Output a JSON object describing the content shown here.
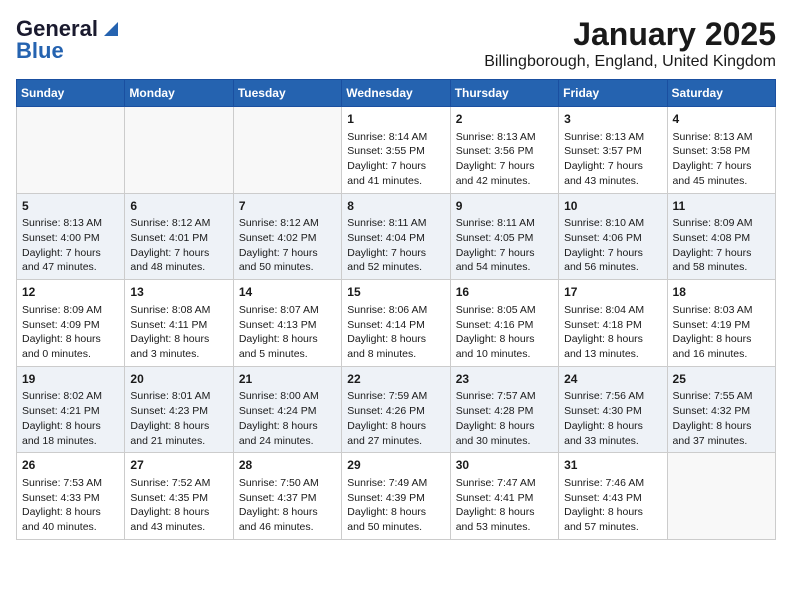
{
  "header": {
    "logo_line1": "General",
    "logo_line2": "Blue",
    "title": "January 2025",
    "subtitle": "Billingborough, England, United Kingdom"
  },
  "weekdays": [
    "Sunday",
    "Monday",
    "Tuesday",
    "Wednesday",
    "Thursday",
    "Friday",
    "Saturday"
  ],
  "weeks": [
    [
      {
        "day": "",
        "empty": true
      },
      {
        "day": "",
        "empty": true
      },
      {
        "day": "",
        "empty": true
      },
      {
        "day": "1",
        "lines": [
          "Sunrise: 8:14 AM",
          "Sunset: 3:55 PM",
          "Daylight: 7 hours",
          "and 41 minutes."
        ]
      },
      {
        "day": "2",
        "lines": [
          "Sunrise: 8:13 AM",
          "Sunset: 3:56 PM",
          "Daylight: 7 hours",
          "and 42 minutes."
        ]
      },
      {
        "day": "3",
        "lines": [
          "Sunrise: 8:13 AM",
          "Sunset: 3:57 PM",
          "Daylight: 7 hours",
          "and 43 minutes."
        ]
      },
      {
        "day": "4",
        "lines": [
          "Sunrise: 8:13 AM",
          "Sunset: 3:58 PM",
          "Daylight: 7 hours",
          "and 45 minutes."
        ]
      }
    ],
    [
      {
        "day": "5",
        "lines": [
          "Sunrise: 8:13 AM",
          "Sunset: 4:00 PM",
          "Daylight: 7 hours",
          "and 47 minutes."
        ]
      },
      {
        "day": "6",
        "lines": [
          "Sunrise: 8:12 AM",
          "Sunset: 4:01 PM",
          "Daylight: 7 hours",
          "and 48 minutes."
        ]
      },
      {
        "day": "7",
        "lines": [
          "Sunrise: 8:12 AM",
          "Sunset: 4:02 PM",
          "Daylight: 7 hours",
          "and 50 minutes."
        ]
      },
      {
        "day": "8",
        "lines": [
          "Sunrise: 8:11 AM",
          "Sunset: 4:04 PM",
          "Daylight: 7 hours",
          "and 52 minutes."
        ]
      },
      {
        "day": "9",
        "lines": [
          "Sunrise: 8:11 AM",
          "Sunset: 4:05 PM",
          "Daylight: 7 hours",
          "and 54 minutes."
        ]
      },
      {
        "day": "10",
        "lines": [
          "Sunrise: 8:10 AM",
          "Sunset: 4:06 PM",
          "Daylight: 7 hours",
          "and 56 minutes."
        ]
      },
      {
        "day": "11",
        "lines": [
          "Sunrise: 8:09 AM",
          "Sunset: 4:08 PM",
          "Daylight: 7 hours",
          "and 58 minutes."
        ]
      }
    ],
    [
      {
        "day": "12",
        "lines": [
          "Sunrise: 8:09 AM",
          "Sunset: 4:09 PM",
          "Daylight: 8 hours",
          "and 0 minutes."
        ]
      },
      {
        "day": "13",
        "lines": [
          "Sunrise: 8:08 AM",
          "Sunset: 4:11 PM",
          "Daylight: 8 hours",
          "and 3 minutes."
        ]
      },
      {
        "day": "14",
        "lines": [
          "Sunrise: 8:07 AM",
          "Sunset: 4:13 PM",
          "Daylight: 8 hours",
          "and 5 minutes."
        ]
      },
      {
        "day": "15",
        "lines": [
          "Sunrise: 8:06 AM",
          "Sunset: 4:14 PM",
          "Daylight: 8 hours",
          "and 8 minutes."
        ]
      },
      {
        "day": "16",
        "lines": [
          "Sunrise: 8:05 AM",
          "Sunset: 4:16 PM",
          "Daylight: 8 hours",
          "and 10 minutes."
        ]
      },
      {
        "day": "17",
        "lines": [
          "Sunrise: 8:04 AM",
          "Sunset: 4:18 PM",
          "Daylight: 8 hours",
          "and 13 minutes."
        ]
      },
      {
        "day": "18",
        "lines": [
          "Sunrise: 8:03 AM",
          "Sunset: 4:19 PM",
          "Daylight: 8 hours",
          "and 16 minutes."
        ]
      }
    ],
    [
      {
        "day": "19",
        "lines": [
          "Sunrise: 8:02 AM",
          "Sunset: 4:21 PM",
          "Daylight: 8 hours",
          "and 18 minutes."
        ]
      },
      {
        "day": "20",
        "lines": [
          "Sunrise: 8:01 AM",
          "Sunset: 4:23 PM",
          "Daylight: 8 hours",
          "and 21 minutes."
        ]
      },
      {
        "day": "21",
        "lines": [
          "Sunrise: 8:00 AM",
          "Sunset: 4:24 PM",
          "Daylight: 8 hours",
          "and 24 minutes."
        ]
      },
      {
        "day": "22",
        "lines": [
          "Sunrise: 7:59 AM",
          "Sunset: 4:26 PM",
          "Daylight: 8 hours",
          "and 27 minutes."
        ]
      },
      {
        "day": "23",
        "lines": [
          "Sunrise: 7:57 AM",
          "Sunset: 4:28 PM",
          "Daylight: 8 hours",
          "and 30 minutes."
        ]
      },
      {
        "day": "24",
        "lines": [
          "Sunrise: 7:56 AM",
          "Sunset: 4:30 PM",
          "Daylight: 8 hours",
          "and 33 minutes."
        ]
      },
      {
        "day": "25",
        "lines": [
          "Sunrise: 7:55 AM",
          "Sunset: 4:32 PM",
          "Daylight: 8 hours",
          "and 37 minutes."
        ]
      }
    ],
    [
      {
        "day": "26",
        "lines": [
          "Sunrise: 7:53 AM",
          "Sunset: 4:33 PM",
          "Daylight: 8 hours",
          "and 40 minutes."
        ]
      },
      {
        "day": "27",
        "lines": [
          "Sunrise: 7:52 AM",
          "Sunset: 4:35 PM",
          "Daylight: 8 hours",
          "and 43 minutes."
        ]
      },
      {
        "day": "28",
        "lines": [
          "Sunrise: 7:50 AM",
          "Sunset: 4:37 PM",
          "Daylight: 8 hours",
          "and 46 minutes."
        ]
      },
      {
        "day": "29",
        "lines": [
          "Sunrise: 7:49 AM",
          "Sunset: 4:39 PM",
          "Daylight: 8 hours",
          "and 50 minutes."
        ]
      },
      {
        "day": "30",
        "lines": [
          "Sunrise: 7:47 AM",
          "Sunset: 4:41 PM",
          "Daylight: 8 hours",
          "and 53 minutes."
        ]
      },
      {
        "day": "31",
        "lines": [
          "Sunrise: 7:46 AM",
          "Sunset: 4:43 PM",
          "Daylight: 8 hours",
          "and 57 minutes."
        ]
      },
      {
        "day": "",
        "empty": true
      }
    ]
  ]
}
